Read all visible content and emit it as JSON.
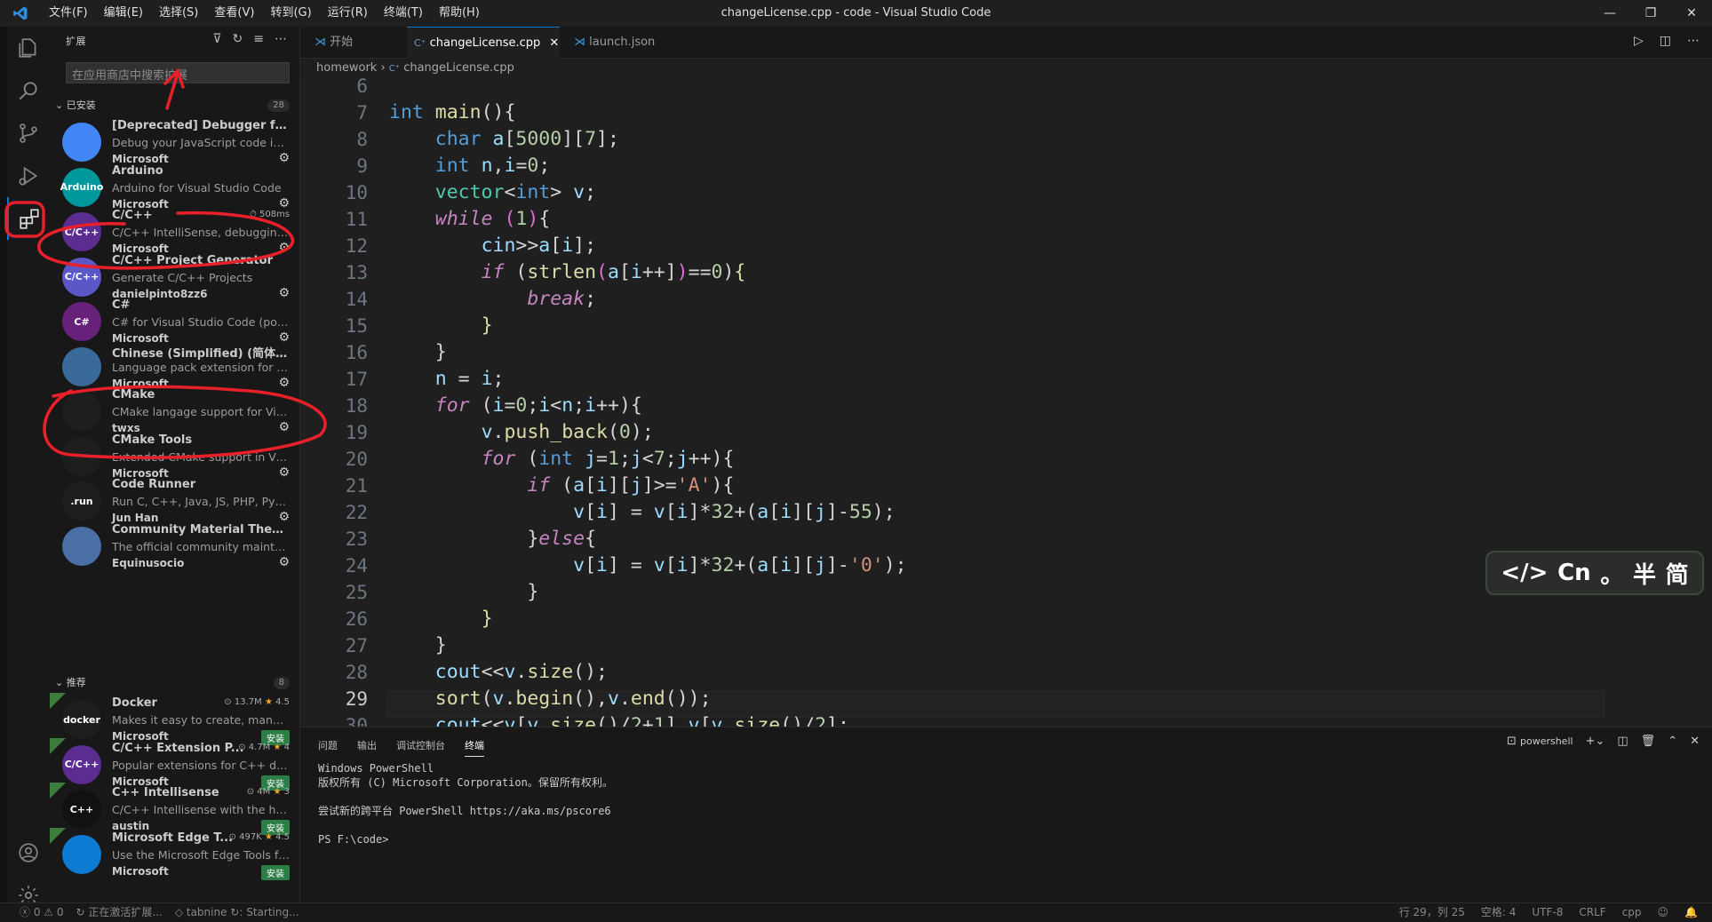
{
  "menu": [
    "文件(F)",
    "编辑(E)",
    "选择(S)",
    "查看(V)",
    "转到(G)",
    "运行(R)",
    "终端(T)",
    "帮助(H)"
  ],
  "window_title": "changeLicense.cpp - code - Visual Studio Code",
  "sidebar": {
    "header": "扩展",
    "search_placeholder": "在应用商店中搜索扩展",
    "installed_label": "已安装",
    "installed_count": "28",
    "recommended_label": "推荐",
    "recommended_count": "8",
    "installed": [
      {
        "name": "[Deprecated] Debugger for Ch...",
        "desc": "Debug your JavaScript code in th...",
        "publisher": "Microsoft",
        "icon": "chrome-icon",
        "icon_text": "",
        "color": "#4285f4"
      },
      {
        "name": "Arduino",
        "desc": "Arduino for Visual Studio Code",
        "publisher": "Microsoft",
        "icon": "arduino-icon",
        "icon_text": "Arduino",
        "color": "#00979d"
      },
      {
        "name": "C/C++",
        "desc": "C/C++ IntelliSense, debugging, a...",
        "publisher": "Microsoft",
        "icon": "cpp-icon",
        "icon_text": "C/C++",
        "color": "#5c2d91",
        "meta": "508ms"
      },
      {
        "name": "C/C++ Project Generator",
        "desc": "Generate C/C++ Projects",
        "publisher": "danielpinto8zz6",
        "icon": "cpp-generator-icon",
        "icon_text": "C/C++",
        "color": "#5b57c6"
      },
      {
        "name": "C#",
        "desc": "C# for Visual Studio Code (power...",
        "publisher": "Microsoft",
        "icon": "csharp-icon",
        "icon_text": "C#",
        "color": "#68217a"
      },
      {
        "name": "Chinese (Simplified) (简体中文)...",
        "desc": "Language pack extension for Chi...",
        "publisher": "Microsoft",
        "icon": "globe-icon",
        "icon_text": "",
        "color": "#3a6a9a"
      },
      {
        "name": "CMake",
        "desc": "CMake langage support for Visu...",
        "publisher": "twxs",
        "icon": "cmake-icon",
        "icon_text": "",
        "color": "#1e1e1e"
      },
      {
        "name": "CMake Tools",
        "desc": "Extended CMake support in Visu...",
        "publisher": "Microsoft",
        "icon": "cmake-tools-icon",
        "icon_text": "",
        "color": "#1e1e1e"
      },
      {
        "name": "Code Runner",
        "desc": "Run C, C++, Java, JS, PHP, Pytho...",
        "publisher": "Jun Han",
        "icon": "run-icon",
        "icon_text": ".run",
        "color": "#1e1e1e"
      },
      {
        "name": "Community Material Theme",
        "desc": "The official community maintain...",
        "publisher": "Equinusocio",
        "icon": "material-theme-icon",
        "icon_text": "",
        "color": "#4a6fa5"
      }
    ],
    "recommended": [
      {
        "name": "Docker",
        "desc": "Makes it easy to create, manage, ...",
        "publisher": "Microsoft",
        "icon": "docker-icon",
        "icon_text": "docker",
        "color": "#1e1e1e",
        "downloads": "13.7M",
        "rating": "4.5",
        "install": "安装"
      },
      {
        "name": "C/C++ Extension P...",
        "desc": "Popular extensions for C++ deve...",
        "publisher": "Microsoft",
        "icon": "cpp-pack-icon",
        "icon_text": "C/C++",
        "color": "#5c2d91",
        "downloads": "4.7M",
        "rating": "4",
        "install": "安装"
      },
      {
        "name": "C++ Intellisense",
        "desc": "C/C++ Intellisense with the help ...",
        "publisher": "austin",
        "icon": "cpp-intellisense-icon",
        "icon_text": "C++",
        "color": "#111111",
        "downloads": "4M",
        "rating": "3",
        "install": "安装"
      },
      {
        "name": "Microsoft Edge T...",
        "desc": "Use the Microsoft Edge Tools fro...",
        "publisher": "Microsoft",
        "icon": "edge-icon",
        "icon_text": "",
        "color": "#0c7bd4",
        "downloads": "497K",
        "rating": "4.5",
        "install": "安装"
      }
    ]
  },
  "tabs": [
    {
      "label": "开始",
      "icon": "vscode-icon"
    },
    {
      "label": "changeLicense.cpp",
      "icon": "cpp-file-icon",
      "active": true
    },
    {
      "label": "launch.json",
      "icon": "vscode-icon"
    }
  ],
  "breadcrumb": {
    "folder": "homework",
    "file": "changeLicense.cpp"
  },
  "editor": {
    "line_numbers": [
      "6",
      "7",
      "8",
      "9",
      "10",
      "11",
      "12",
      "13",
      "14",
      "15",
      "16",
      "17",
      "18",
      "19",
      "20",
      "21",
      "22",
      "23",
      "24",
      "25",
      "26",
      "27",
      "28",
      "29",
      "30"
    ],
    "current_line": "29"
  },
  "ime": {
    "code": "</>",
    "lang": "Cn",
    "punct": "。",
    "width": "半",
    "script": "简"
  },
  "panel": {
    "tabs": [
      "问题",
      "输出",
      "调试控制台",
      "终端"
    ],
    "active": "终端",
    "shell": "powershell",
    "terminal": [
      "Windows PowerShell",
      "版权所有 (C) Microsoft Corporation。保留所有权利。",
      "",
      "尝试新的跨平台 PowerShell https://aka.ms/pscore6",
      "",
      "PS F:\\code>"
    ]
  },
  "status": {
    "errors": "0",
    "warnings": "0",
    "activating": "正在激活扩展...",
    "tabnine": "tabnine",
    "starting": "Starting...",
    "position": "行 29，列 25",
    "spaces": "空格: 4",
    "encoding": "UTF-8",
    "eol": "CRLF",
    "language": "cpp"
  },
  "colors": {
    "accent": "#0078d4",
    "annotation": "#e8202a"
  }
}
